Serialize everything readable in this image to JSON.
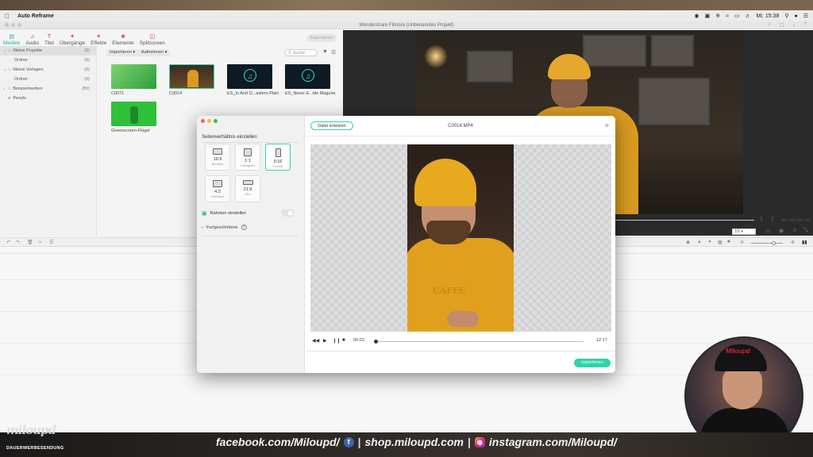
{
  "menubar": {
    "app_name": "Auto Reframe",
    "time": "Mi. 15:38"
  },
  "window": {
    "title": "Wondershare Filmora (Unbenanntes Projekt)"
  },
  "toolbar": {
    "tabs": [
      {
        "label": "Medien",
        "icon": "media-icon"
      },
      {
        "label": "Audio",
        "icon": "music-note-icon"
      },
      {
        "label": "Titel",
        "icon": "title-t-icon"
      },
      {
        "label": "Übergänge",
        "icon": "transition-icon"
      },
      {
        "label": "Effekte",
        "icon": "effects-sparkle-icon"
      },
      {
        "label": "Elemente",
        "icon": "elements-icon"
      },
      {
        "label": "Splitscreen",
        "icon": "splitscreen-icon"
      }
    ],
    "export_label": "Exportieren"
  },
  "sidebar": {
    "items": [
      {
        "label": "Meine Projekte",
        "count": "(6)"
      },
      {
        "label": "Ordner",
        "count": "(6)"
      },
      {
        "label": "Meine Vorlagen",
        "count": "(0)"
      },
      {
        "label": "Ordner",
        "count": "(0)"
      },
      {
        "label": "Beispielmedien",
        "count": "(55)"
      },
      {
        "label": "Pexels",
        "count": ""
      }
    ]
  },
  "media": {
    "import_label": "Importieren",
    "record_label": "Aufnehmen",
    "search_placeholder": "Suche",
    "items": [
      {
        "label": "C0071"
      },
      {
        "label": "C0014"
      },
      {
        "label": "ES_In And O...astern Plain"
      },
      {
        "label": "ES_Never E...ttle Maguire"
      },
      {
        "label": "Greenscreen-Flügel"
      }
    ]
  },
  "preview": {
    "timecode": "00:00:00:00",
    "ratio": "1/2"
  },
  "dialog": {
    "section_title": "Seitenverhältnis einstellen",
    "ratios": [
      {
        "ratio": "16:9",
        "sub": "Breitbild"
      },
      {
        "ratio": "1:1",
        "sub": "Instagram"
      },
      {
        "ratio": "9:16",
        "sub": "Portrait"
      },
      {
        "ratio": "4:3",
        "sub": "Standard"
      },
      {
        "ratio": "21:9",
        "sub": "Film"
      }
    ],
    "selected_ratio": "9:16",
    "frame_label": "Rahmen einstellen",
    "frame_enabled": false,
    "advanced_label": "Fortgeschrittene",
    "replace_label": "Datei ersetzen",
    "file_name": "C0014.MP4",
    "current_time": "00:03",
    "total_time": "12:17",
    "export_label": "exportieren",
    "accent": "#2fd3a9"
  },
  "overlay": {
    "brand": "miloupd",
    "brand_sub": "DAUERWERBESENDUNG",
    "facebook": "facebook.com/Miloupd/",
    "shop": "shop.miloupd.com",
    "instagram": "instagram.com/Miloupd/",
    "webcam_cap_logo": "Miloupd"
  }
}
